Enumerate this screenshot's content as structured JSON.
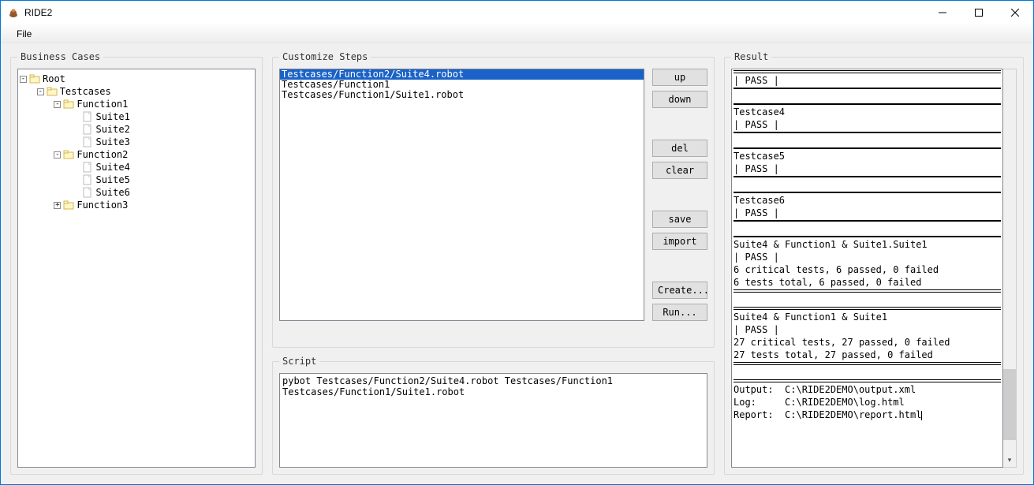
{
  "window": {
    "title": "RIDE2"
  },
  "menu": {
    "file": "File"
  },
  "panels": {
    "business_cases": "Business Cases",
    "customize_steps": "Customize Steps",
    "script": "Script",
    "result": "Result"
  },
  "tree": {
    "root": "Root",
    "testcases": "Testcases",
    "function1": "Function1",
    "suite1": "Suite1",
    "suite2": "Suite2",
    "suite3": "Suite3",
    "function2": "Function2",
    "suite4": "Suite4",
    "suite5": "Suite5",
    "suite6": "Suite6",
    "function3": "Function3"
  },
  "steps": [
    {
      "text": "Testcases/Function2/Suite4.robot",
      "selected": true
    },
    {
      "text": "Testcases/Function1",
      "selected": false
    },
    {
      "text": "Testcases/Function1/Suite1.robot",
      "selected": false
    }
  ],
  "buttons": {
    "up": "up",
    "down": "down",
    "del": "del",
    "clear": "clear",
    "save": "save",
    "import": "import",
    "create": "Create...",
    "run": "Run..."
  },
  "script_text": "pybot Testcases/Function2/Suite4.robot Testcases/Function1 Testcases/Function1/Suite1.robot",
  "result_lines": [
    {
      "t": "hr_double"
    },
    {
      "t": "text",
      "v": "| PASS |"
    },
    {
      "t": "hr"
    },
    {
      "t": "blank"
    },
    {
      "t": "hr"
    },
    {
      "t": "text",
      "v": "Testcase4"
    },
    {
      "t": "text",
      "v": "| PASS |"
    },
    {
      "t": "hr"
    },
    {
      "t": "blank"
    },
    {
      "t": "hr"
    },
    {
      "t": "text",
      "v": "Testcase5"
    },
    {
      "t": "text",
      "v": "| PASS |"
    },
    {
      "t": "hr"
    },
    {
      "t": "blank"
    },
    {
      "t": "hr"
    },
    {
      "t": "text",
      "v": "Testcase6"
    },
    {
      "t": "text",
      "v": "| PASS |"
    },
    {
      "t": "hr"
    },
    {
      "t": "blank"
    },
    {
      "t": "hr"
    },
    {
      "t": "text",
      "v": "Suite4 & Function1 & Suite1.Suite1"
    },
    {
      "t": "text",
      "v": "| PASS |"
    },
    {
      "t": "text",
      "v": "6 critical tests, 6 passed, 0 failed"
    },
    {
      "t": "text",
      "v": "6 tests total, 6 passed, 0 failed"
    },
    {
      "t": "hr_double"
    },
    {
      "t": "blank"
    },
    {
      "t": "hr_double"
    },
    {
      "t": "text",
      "v": "Suite4 & Function1 & Suite1"
    },
    {
      "t": "text",
      "v": "| PASS |"
    },
    {
      "t": "text",
      "v": "27 critical tests, 27 passed, 0 failed"
    },
    {
      "t": "text",
      "v": "27 tests total, 27 passed, 0 failed"
    },
    {
      "t": "hr_double"
    },
    {
      "t": "blank"
    },
    {
      "t": "hr_double"
    },
    {
      "t": "text",
      "v": "Output:  C:\\RIDE2DEMO\\output.xml"
    },
    {
      "t": "text",
      "v": "Log:     C:\\RIDE2DEMO\\log.html"
    },
    {
      "t": "text_caret",
      "v": "Report:  C:\\RIDE2DEMO\\report.html"
    }
  ]
}
